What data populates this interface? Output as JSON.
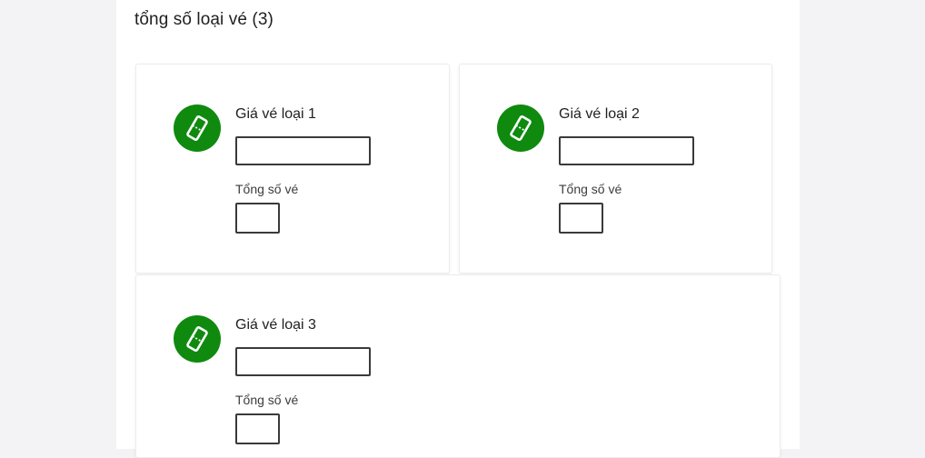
{
  "section": {
    "title": "tổng số loại vé (3)"
  },
  "colors": {
    "accent": "#0f8a0f",
    "page_background": "#f3f3f6",
    "panel_background": "#ffffff"
  },
  "ticket_types": [
    {
      "icon": "ticket-icon",
      "price_label": "Giá vé loại 1",
      "price_value": "",
      "count_label": "Tổng số vé",
      "count_value": ""
    },
    {
      "icon": "ticket-icon",
      "price_label": "Giá vé loại 2",
      "price_value": "",
      "count_label": "Tổng số vé",
      "count_value": ""
    },
    {
      "icon": "ticket-icon",
      "price_label": "Giá vé loại 3",
      "price_value": "",
      "count_label": "Tổng số vé",
      "count_value": ""
    }
  ]
}
